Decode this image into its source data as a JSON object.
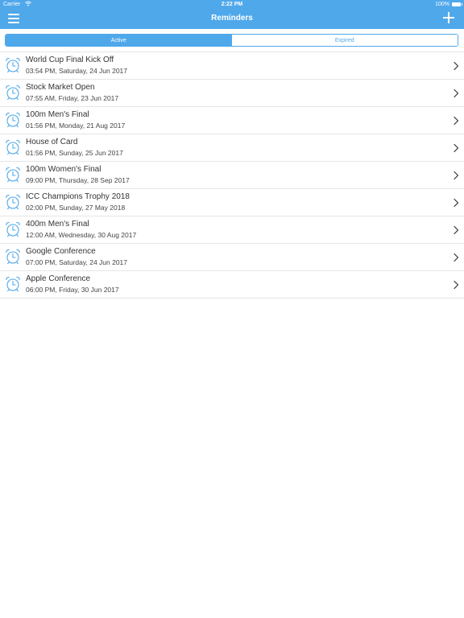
{
  "status_bar": {
    "carrier": "Carrier",
    "time": "2:22 PM",
    "battery": "100%"
  },
  "nav": {
    "title": "Reminders",
    "menu_icon": "hamburger-menu-icon",
    "add_icon": "plus-icon"
  },
  "tabs": [
    {
      "label": "Active",
      "selected": true
    },
    {
      "label": "Expired",
      "selected": false
    }
  ],
  "reminders": [
    {
      "title": "World Cup Final Kick Off",
      "when": "03:54 PM, Saturday, 24 Jun 2017"
    },
    {
      "title": "Stock Market Open",
      "when": "07:55 AM, Friday, 23 Jun 2017"
    },
    {
      "title": "100m Men's Final",
      "when": "01:56 PM, Monday, 21 Aug 2017"
    },
    {
      "title": "House of Card",
      "when": "01:56 PM, Sunday, 25 Jun 2017"
    },
    {
      "title": "100m Women's Final",
      "when": "09:00 PM, Thursday, 28 Sep 2017"
    },
    {
      "title": "ICC Champions Trophy 2018",
      "when": "02:00 PM, Sunday, 27 May 2018"
    },
    {
      "title": "400m Men's Final",
      "when": "12:00 AM, Wednesday, 30 Aug 2017"
    },
    {
      "title": "Google Conference",
      "when": "07:00 PM, Saturday, 24 Jun 2017"
    },
    {
      "title": "Apple Conference",
      "when": "06:00 PM, Friday, 30 Jun 2017"
    }
  ],
  "colors": {
    "accent": "#4fa8ea",
    "divider": "#e6e6e6"
  }
}
